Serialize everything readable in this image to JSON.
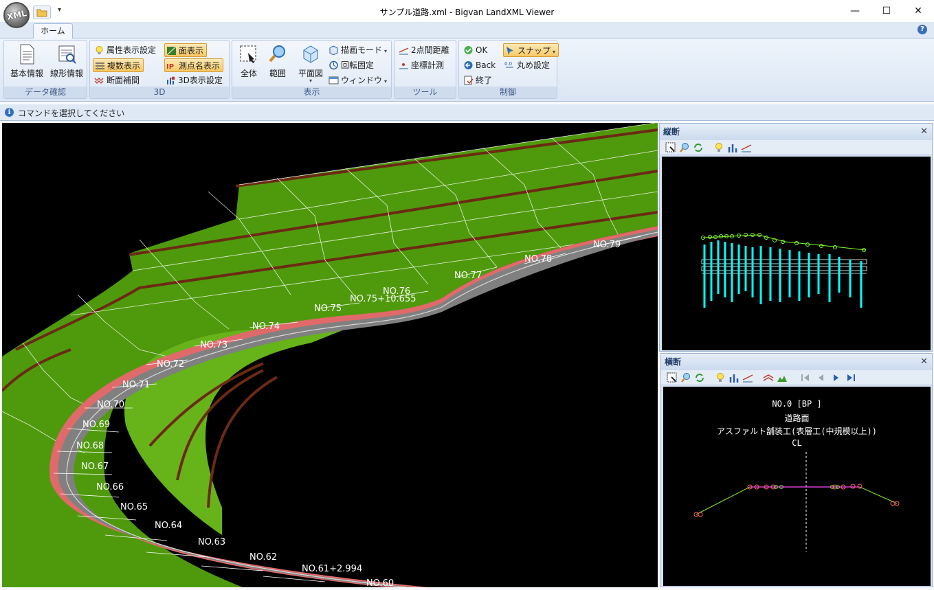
{
  "window": {
    "title": "サンプル道路.xml - Bigvan LandXML Viewer",
    "logo_text": "XML"
  },
  "ribbon": {
    "tab_home": "ホーム",
    "groups": {
      "data": {
        "label": "データ確認",
        "basic_info": "基本情報",
        "alignment_info": "線形情報"
      },
      "view3d": {
        "label": "3D",
        "attr_display_settings": "属性表示設定",
        "multi_display": "複数表示",
        "section_interp": "断面補間",
        "face_display": "面表示",
        "point_name_display": "測点名表示",
        "display3d_settings": "3D表示設定"
      },
      "display": {
        "label": "表示",
        "all": "全体",
        "range": "範囲",
        "plan": "平面図",
        "draw_mode": "描画モード",
        "rotation_fix": "回転固定",
        "window": "ウィンドウ"
      },
      "tools": {
        "label": "ツール",
        "two_point_distance": "2点間距離",
        "coord_measure": "座標計測"
      },
      "control": {
        "label": "制御",
        "ok": "OK",
        "back": "Back",
        "end": "終了",
        "snap": "スナップ",
        "rounding": "丸め設定"
      }
    }
  },
  "status": {
    "text": "コマンドを選択してください"
  },
  "viewport": {
    "station_labels": [
      {
        "text": "NO.79"
      },
      {
        "text": "NO.78"
      },
      {
        "text": "NO.77"
      },
      {
        "text": "NO.76"
      },
      {
        "text": "NO.75+10.655"
      },
      {
        "text": "NO.75"
      },
      {
        "text": "NO.74"
      },
      {
        "text": "NO.73"
      },
      {
        "text": "NO.72"
      },
      {
        "text": "NO.71"
      },
      {
        "text": "NO.70"
      },
      {
        "text": "NO.69"
      },
      {
        "text": "NO.68"
      },
      {
        "text": "NO.67"
      },
      {
        "text": "NO.66"
      },
      {
        "text": "NO.65"
      },
      {
        "text": "NO.64"
      },
      {
        "text": "NO.63"
      },
      {
        "text": "NO.62"
      },
      {
        "text": "NO.61+2.994"
      },
      {
        "text": "NO.60"
      }
    ],
    "colors": {
      "slope": "#4f9a0c",
      "slope_light": "#6cbe1a",
      "road": "#808080",
      "shoulder": "#e06a6a",
      "berm": "#6b2a14",
      "label": "#ffffff"
    }
  },
  "profile_pane": {
    "title": "縦断",
    "colors": {
      "profile_line": "#7fff2a",
      "labels": "#00ffff"
    }
  },
  "cross_pane": {
    "title": "横断",
    "station": "NO.0 [BP  ]",
    "surface": "道路面",
    "material": "アスファルト舗装工(表層工(中規模以上))",
    "cl": "CL",
    "colors": {
      "surface": "#7fd32a",
      "pavement": "#d23cd2",
      "points": "#ff6666"
    }
  }
}
